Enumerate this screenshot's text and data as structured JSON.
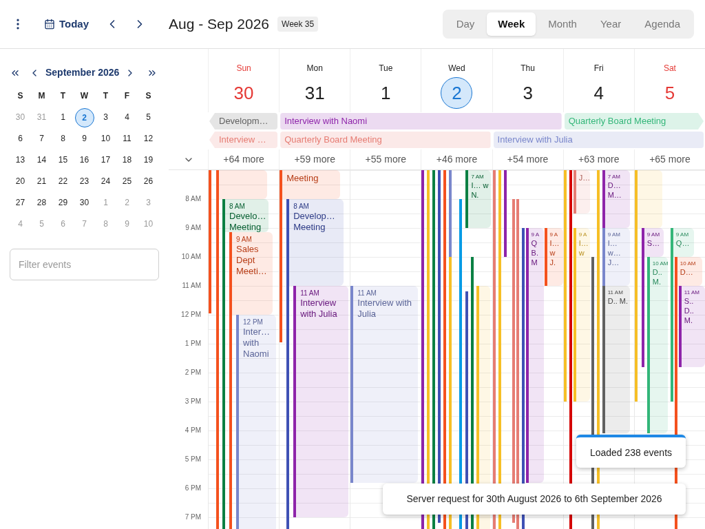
{
  "toolbar": {
    "today": "Today",
    "title": "Aug - Sep 2026",
    "week_badge": "Week 35"
  },
  "views": [
    {
      "label": "Day",
      "selected": false
    },
    {
      "label": "Week",
      "selected": true
    },
    {
      "label": "Month",
      "selected": false
    },
    {
      "label": "Year",
      "selected": false
    },
    {
      "label": "Agenda",
      "selected": false
    }
  ],
  "mini_calendar": {
    "month": "September 2026",
    "weekdays": [
      "S",
      "M",
      "T",
      "W",
      "T",
      "F",
      "S"
    ],
    "weeks": [
      [
        {
          "day": "30",
          "outside": true,
          "selected": false
        },
        {
          "day": "31",
          "outside": true,
          "selected": false
        },
        {
          "day": "1",
          "outside": false,
          "selected": false
        },
        {
          "day": "2",
          "outside": false,
          "selected": true
        },
        {
          "day": "3",
          "outside": false,
          "selected": false
        },
        {
          "day": "4",
          "outside": false,
          "selected": false
        },
        {
          "day": "5",
          "outside": false,
          "selected": false
        }
      ],
      [
        {
          "day": "6",
          "outside": false,
          "selected": false
        },
        {
          "day": "7",
          "outside": false,
          "selected": false
        },
        {
          "day": "8",
          "outside": false,
          "selected": false
        },
        {
          "day": "9",
          "outside": false,
          "selected": false
        },
        {
          "day": "10",
          "outside": false,
          "selected": false
        },
        {
          "day": "11",
          "outside": false,
          "selected": false
        },
        {
          "day": "12",
          "outside": false,
          "selected": false
        }
      ],
      [
        {
          "day": "13",
          "outside": false,
          "selected": false
        },
        {
          "day": "14",
          "outside": false,
          "selected": false
        },
        {
          "day": "15",
          "outside": false,
          "selected": false
        },
        {
          "day": "16",
          "outside": false,
          "selected": false
        },
        {
          "day": "17",
          "outside": false,
          "selected": false
        },
        {
          "day": "18",
          "outside": false,
          "selected": false
        },
        {
          "day": "19",
          "outside": false,
          "selected": false
        }
      ],
      [
        {
          "day": "20",
          "outside": false,
          "selected": false
        },
        {
          "day": "21",
          "outside": false,
          "selected": false
        },
        {
          "day": "22",
          "outside": false,
          "selected": false
        },
        {
          "day": "23",
          "outside": false,
          "selected": false
        },
        {
          "day": "24",
          "outside": false,
          "selected": false
        },
        {
          "day": "25",
          "outside": false,
          "selected": false
        },
        {
          "day": "26",
          "outside": false,
          "selected": false
        }
      ],
      [
        {
          "day": "27",
          "outside": false,
          "selected": false
        },
        {
          "day": "28",
          "outside": false,
          "selected": false
        },
        {
          "day": "29",
          "outside": false,
          "selected": false
        },
        {
          "day": "30",
          "outside": false,
          "selected": false
        },
        {
          "day": "1",
          "outside": true,
          "selected": false
        },
        {
          "day": "2",
          "outside": true,
          "selected": false
        },
        {
          "day": "3",
          "outside": true,
          "selected": false
        }
      ],
      [
        {
          "day": "4",
          "outside": true,
          "selected": false
        },
        {
          "day": "5",
          "outside": true,
          "selected": false
        },
        {
          "day": "6",
          "outside": true,
          "selected": false
        },
        {
          "day": "7",
          "outside": true,
          "selected": false
        },
        {
          "day": "8",
          "outside": true,
          "selected": false
        },
        {
          "day": "9",
          "outside": true,
          "selected": false
        },
        {
          "day": "10",
          "outside": true,
          "selected": false
        }
      ]
    ]
  },
  "filter": {
    "placeholder": "Filter events"
  },
  "days": [
    {
      "name": "Sun",
      "date": "30",
      "weekend": true,
      "today": false,
      "more": "+64 more",
      "events": [
        {
          "color": "#f4511e"
        },
        {
          "color": "#f4511e"
        },
        {
          "color": "#f4511e"
        },
        {
          "color": "#0b8043",
          "time": "8 AM",
          "title": "Develo… Meeting"
        },
        {
          "color": "#0b8043"
        },
        {
          "color": "#f4511e",
          "time": "9 AM",
          "title": "Sales Dept Meeti…"
        },
        {
          "color": "#f4511e"
        },
        {
          "color": "#7986cb",
          "time": "12 PM",
          "title": "Inter… with Naomi"
        }
      ]
    },
    {
      "name": "Mon",
      "date": "31",
      "weekend": false,
      "today": false,
      "more": "+59 more",
      "events": [
        {
          "color": "#f4511e",
          "title": "Meeting"
        },
        {
          "color": "#f4511e"
        },
        {
          "color": "#3f51b5",
          "time": "8 AM",
          "title": "Develop… Meeting"
        },
        {
          "color": "#3f51b5"
        },
        {
          "color": "#8e24aa",
          "time": "11 AM",
          "title": "Interview with Julia"
        }
      ]
    },
    {
      "name": "Tue",
      "date": "1",
      "weekend": false,
      "today": false,
      "more": "+55 more",
      "events": [
        {
          "color": "#7986cb",
          "time": "11 AM",
          "title": "Interview with Julia"
        }
      ]
    },
    {
      "name": "Wed",
      "date": "2",
      "weekend": false,
      "today": true,
      "more": "+46 more",
      "events": [
        {
          "color": "#8e24aa"
        },
        {
          "color": "#f6bf26"
        },
        {
          "color": "#0b8043"
        },
        {
          "color": "#3f51b5"
        },
        {
          "color": "#f4511e"
        },
        {
          "color": "#7986cb"
        },
        {
          "color": "#f6bf26"
        },
        {
          "color": "#039be5"
        },
        {
          "color": "#0b8043",
          "time": "7 AM",
          "title": "I… w N."
        },
        {
          "color": "#3f51b5"
        },
        {
          "color": "#0b8043"
        },
        {
          "color": "#f6bf26"
        }
      ]
    },
    {
      "name": "Thu",
      "date": "3",
      "weekend": false,
      "today": false,
      "more": "+54 more",
      "events": [
        {
          "color": "#e67c73"
        },
        {
          "color": "#f6bf26"
        },
        {
          "color": "#8e24aa"
        },
        {
          "color": "#e67c73"
        },
        {
          "color": "#e67c73"
        },
        {
          "color": "#3f51b5"
        },
        {
          "color": "#8e24aa",
          "time": "9 A",
          "title": "Q B. M"
        },
        {
          "color": "#f4511e",
          "time": "9 A",
          "title": "I… w J."
        }
      ]
    },
    {
      "name": "Fri",
      "date": "4",
      "weekend": false,
      "today": false,
      "more": "+63 more",
      "events": [
        {
          "color": "#f6bf26"
        },
        {
          "color": "#d50000"
        },
        {
          "color": "#e67c73",
          "title": "J…"
        },
        {
          "color": "#f6bf26",
          "time": "9 A",
          "title": "I… w"
        },
        {
          "color": "#616161"
        },
        {
          "color": "#f6bf26"
        },
        {
          "color": "#8e24aa",
          "time": "7 AM",
          "title": "D… M…"
        },
        {
          "color": "#7986cb",
          "time": "9 AM",
          "title": "I… w… J…"
        },
        {
          "color": "#616161",
          "time": "11 AM",
          "title": "D.. M."
        }
      ]
    },
    {
      "name": "Sat",
      "date": "5",
      "weekend": true,
      "today": false,
      "more": "+65 more",
      "events": [
        {
          "color": "#f6bf26"
        },
        {
          "color": "#f6bf26"
        },
        {
          "color": "#8e24aa",
          "time": "9 AM",
          "title": "S…"
        },
        {
          "color": "#8e24aa"
        },
        {
          "color": "#33b679",
          "time": "10 AM",
          "title": "D.. M."
        },
        {
          "color": "#33b679",
          "time": "9 AM",
          "title": "Q…"
        },
        {
          "color": "#33b679"
        },
        {
          "color": "#f4511e",
          "time": "10 AM",
          "title": "D…"
        },
        {
          "color": "#f4511e"
        },
        {
          "color": "#8e24aa",
          "time": "11 AM",
          "title": "S.. D.. M."
        }
      ]
    }
  ],
  "all_day": [
    [
      {
        "title": "Developm…",
        "color": "#616161",
        "continues_before": true,
        "continues_after": false
      },
      {
        "title": "Interview with Naomi",
        "color": "#8e24aa",
        "continues_before": false,
        "continues_after": false
      },
      {
        "title": "Quarterly Board Meeting",
        "color": "#33b679",
        "continues_before": false,
        "continues_after": true
      }
    ],
    [
      {
        "title": "Interview …",
        "color": "#e67c73",
        "continues_before": true,
        "continues_after": false
      },
      {
        "title": "Quarterly Board Meeting",
        "color": "#e67c73",
        "continues_before": false,
        "continues_after": false
      },
      {
        "title": "Interview with Julia",
        "color": "#7986cb",
        "continues_before": false,
        "continues_after": false
      }
    ]
  ],
  "hours": [
    "8 AM",
    "9 AM",
    "10 AM",
    "11 AM",
    "12 PM",
    "1 PM",
    "2 PM",
    "3 PM",
    "4 PM",
    "5 PM",
    "6 PM",
    "7 PM"
  ],
  "toasts": [
    "Loaded 238 events",
    "Server request for 30th August 2026 to 6th September 2026"
  ]
}
